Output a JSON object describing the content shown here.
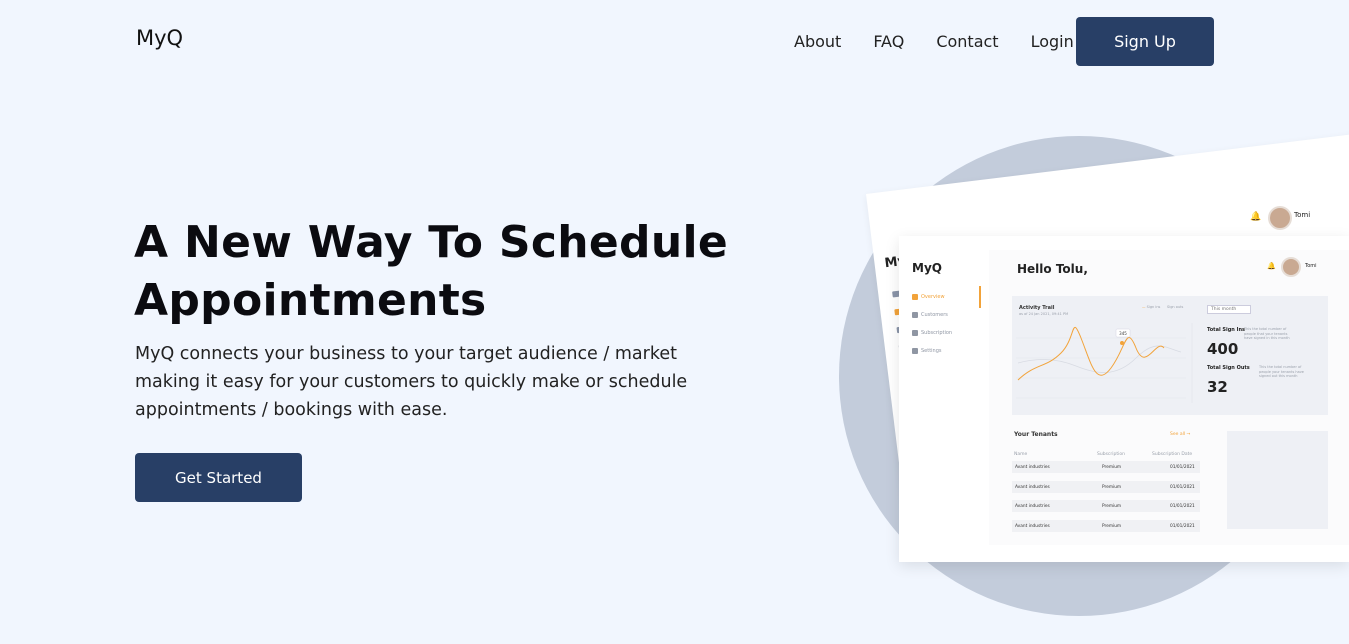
{
  "header": {
    "logo": "MyQ",
    "nav": [
      "About",
      "FAQ",
      "Contact",
      "Login"
    ],
    "signup": "Sign Up"
  },
  "hero": {
    "title_line1": "A New Way To Schedule",
    "title_line2": "Appointments",
    "description": "MyQ connects your business to your target audience / market making it easy for your customers to quickly make or schedule appointments / bookings with ease.",
    "cta": "Get Started"
  },
  "mockup": {
    "back": {
      "logo": "MyQ",
      "user": "Tomi"
    },
    "front": {
      "logo": "MyQ",
      "nav": [
        "Overview",
        "Customers",
        "Subscription",
        "Settings"
      ],
      "greeting": "Hello Tolu,",
      "user": "Tomi",
      "chart": {
        "title": "Activity Trail",
        "subtitle": "as of 24 Jan 2021, 09:41 PM",
        "legend": [
          "Sign ins",
          "Sign outs"
        ],
        "tooltip": "345",
        "filter": "This month"
      },
      "stats": [
        {
          "label": "Total Sign Ins",
          "value": "400",
          "desc": "This the total number of people that your tenants have signed in this month"
        },
        {
          "label": "Total Sign Outs",
          "value": "32",
          "desc": "This the total number of people your tenants have signed out this month"
        }
      ],
      "tenants": {
        "title": "Your Tenants",
        "see_all": "See all",
        "columns": [
          "Name",
          "Subscription",
          "Subscription Date"
        ],
        "rows": [
          [
            "Avant industries",
            "Premium",
            "01/01/2021"
          ],
          [
            "Avant industries",
            "Premium",
            "01/01/2021"
          ],
          [
            "Avant industries",
            "Premium",
            "01/01/2021"
          ],
          [
            "Avant industries",
            "Premium",
            "01/01/2021"
          ]
        ]
      }
    }
  },
  "colors": {
    "background": "#f1f6fe",
    "primary": "#283f66",
    "accent": "#f2a33a",
    "circle": "#c3ccdb"
  }
}
